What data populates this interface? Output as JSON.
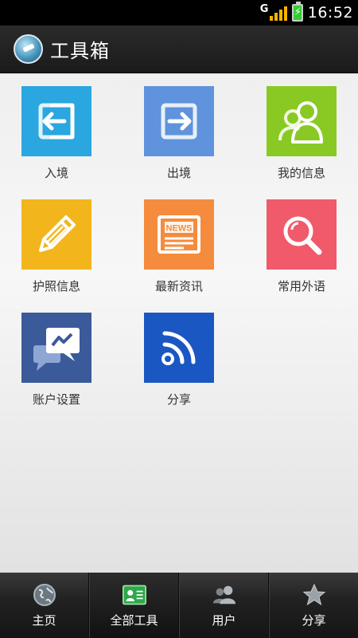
{
  "status_bar": {
    "time": "16:52",
    "signal_letter": "G"
  },
  "header": {
    "title": "工具箱",
    "logo_icon": "globe-plane-icon"
  },
  "tools": [
    {
      "label": "入境",
      "icon": "enter-arrow-icon",
      "color": "#2aa6e0"
    },
    {
      "label": "出境",
      "icon": "exit-arrow-icon",
      "color": "#5f93dd"
    },
    {
      "label": "我的信息",
      "icon": "users-icon",
      "color": "#8ac924"
    },
    {
      "label": "护照信息",
      "icon": "pencil-icon",
      "color": "#f2b51c"
    },
    {
      "label": "最新资讯",
      "icon": "news-icon",
      "color": "#f58b3c"
    },
    {
      "label": "常用外语",
      "icon": "magnifier-icon",
      "color": "#f05a6a"
    },
    {
      "label": "账户设置",
      "icon": "chat-bubbles-icon",
      "color": "#3a5a99"
    },
    {
      "label": "分享",
      "icon": "rss-icon",
      "color": "#1a57c2"
    }
  ],
  "bottom_nav": [
    {
      "label": "主页",
      "icon": "globe-icon",
      "active": false
    },
    {
      "label": "全部工具",
      "icon": "id-card-icon",
      "active": true
    },
    {
      "label": "用户",
      "icon": "users-icon",
      "active": false
    },
    {
      "label": "分享",
      "icon": "star-icon",
      "active": false
    }
  ]
}
